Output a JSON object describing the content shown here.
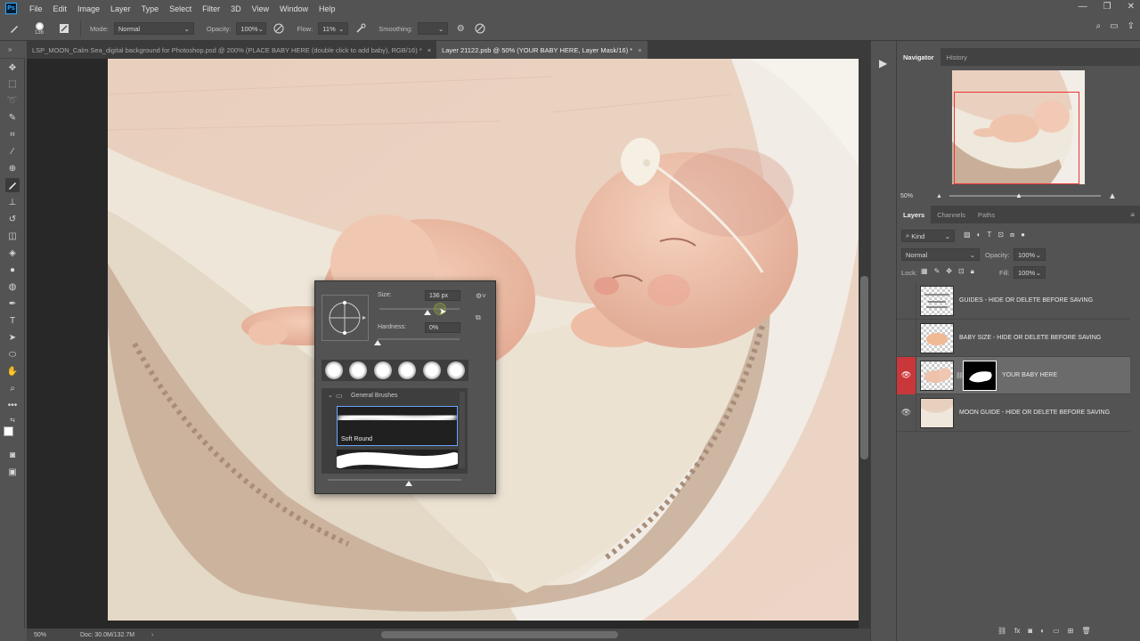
{
  "menubar": {
    "items": [
      "File",
      "Edit",
      "Image",
      "Layer",
      "Type",
      "Select",
      "Filter",
      "3D",
      "View",
      "Window",
      "Help"
    ],
    "app_icon": "Ps"
  },
  "options": {
    "brush_size": "136",
    "mode_label": "Mode:",
    "mode_value": "Normal",
    "opacity_label": "Opacity:",
    "opacity_value": "100%",
    "flow_label": "Flow:",
    "flow_value": "11%",
    "smoothing_label": "Smoothing:",
    "smoothing_value": ""
  },
  "tabs": [
    {
      "title": "LSP_MOON_Calm Sea_digital background for Photoshop.psd @ 200% (PLACE BABY HERE (double click to add baby), RGB/16) *",
      "close": "×"
    },
    {
      "title": "Layer 21122.psb @ 50% (YOUR BABY HERE, Layer Mask/16) *",
      "close": "×"
    }
  ],
  "status": {
    "zoom": "50%",
    "doc": "Doc: 30.0M/132.7M"
  },
  "brush_popup": {
    "size_label": "Size:",
    "size_value": "136 px",
    "size_fraction": 0.27,
    "hardness_label": "Hardness:",
    "hardness_value": "0%",
    "hardness_fraction": 0.0,
    "folder_name": "General Brushes",
    "selected_brush": "Soft Round"
  },
  "navigator": {
    "tabs": [
      "Navigator",
      "History"
    ],
    "zoom": "50%"
  },
  "layers_panel": {
    "tabs": [
      "Layers",
      "Channels",
      "Paths"
    ],
    "filter_kind": "Kind",
    "blend_mode": "Normal",
    "opacity_label": "Opacity:",
    "opacity_value": "100%",
    "lock_label": "Lock:",
    "fill_label": "Fill:",
    "fill_value": "100%",
    "layers": [
      {
        "name": "GUIDES - HIDE OR DELETE BEFORE SAVING",
        "visible": false,
        "selected": false
      },
      {
        "name": "BABY SIZE - HIDE OR DELETE BEFORE SAVING",
        "visible": false,
        "selected": false
      },
      {
        "name": "YOUR BABY HERE",
        "visible": true,
        "selected": true
      },
      {
        "name": "MOON GUIDE - HIDE OR DELETE BEFORE SAVING",
        "visible": true,
        "selected": false
      }
    ]
  },
  "colors": {
    "ui_bg": "#535353",
    "accent_red": "#c9373a",
    "selection_blue": "#6aa3ff"
  }
}
